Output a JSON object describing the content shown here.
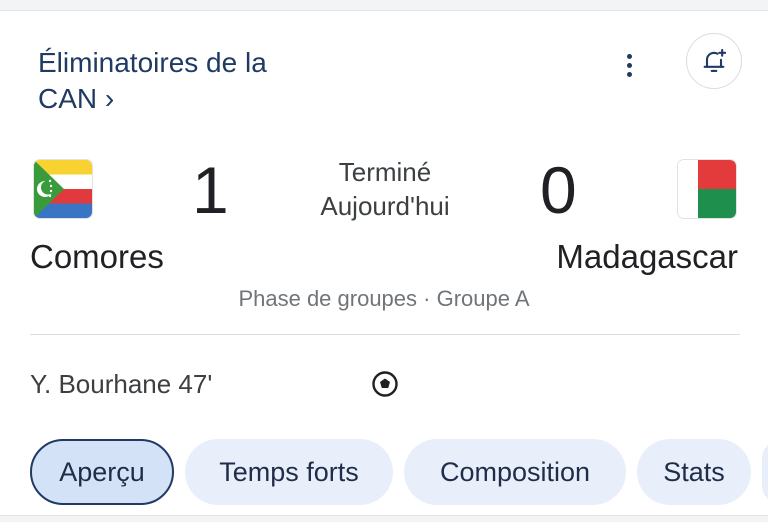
{
  "competition": {
    "title": "Éliminatoires de la CAN ›"
  },
  "header": {
    "more_icon": "more-vert-icon",
    "alert_icon": "add-alert-bell-icon"
  },
  "match": {
    "status": "Terminé",
    "date": "Aujourd'hui",
    "stage": "Phase de groupes · Groupe A",
    "home": {
      "name": "Comores",
      "score": "1",
      "flag_icon": "comoros-flag"
    },
    "away": {
      "name": "Madagascar",
      "score": "0",
      "flag_icon": "madagascar-flag"
    }
  },
  "events": [
    {
      "scorer": "Y. Bourhane 47'",
      "icon": "soccer-ball-icon"
    }
  ],
  "tabs": [
    {
      "label": "Aperçu",
      "active": true
    },
    {
      "label": "Temps forts",
      "active": false
    },
    {
      "label": "Composition",
      "active": false
    },
    {
      "label": "Stats",
      "active": false
    },
    {
      "label": "",
      "active": false
    }
  ],
  "colors": {
    "accent": "#1f3a63",
    "chip_bg": "#e8effa",
    "chip_active_bg": "#d4e2f8",
    "text": "#202124",
    "muted": "#70757a"
  }
}
